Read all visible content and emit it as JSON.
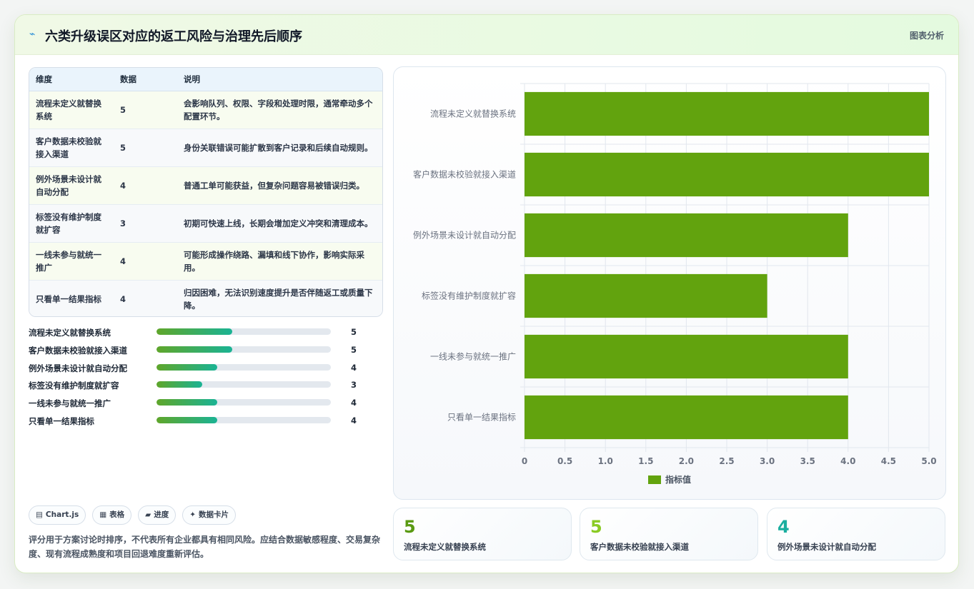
{
  "header": {
    "logo_glyph": "⌁",
    "title": "六类升级误区对应的返工风险与治理先后顺序",
    "tag": "图表分析"
  },
  "table": {
    "columns": [
      "维度",
      "数据",
      "说明"
    ],
    "rows": [
      {
        "dim": "流程未定义就替换系统",
        "value": "5",
        "desc": "会影响队列、权限、字段和处理时限，通常牵动多个配置环节。"
      },
      {
        "dim": "客户数据未校验就接入渠道",
        "value": "5",
        "desc": "身份关联错误可能扩散到客户记录和后续自动规则。"
      },
      {
        "dim": "例外场景未设计就自动分配",
        "value": "4",
        "desc": "普通工单可能获益，但复杂问题容易被错误归类。"
      },
      {
        "dim": "标签没有维护制度就扩容",
        "value": "3",
        "desc": "初期可快速上线，长期会增加定义冲突和清理成本。"
      },
      {
        "dim": "一线未参与就统一推广",
        "value": "4",
        "desc": "可能形成操作绕路、漏填和线下协作，影响实际采用。"
      },
      {
        "dim": "只看单一结果指标",
        "value": "4",
        "desc": "归因困难，无法识别速度提升是否伴随返工或质量下降。"
      }
    ]
  },
  "progress": [
    {
      "label": "流程未定义就替换系统",
      "value": 5,
      "max": 11.5
    },
    {
      "label": "客户数据未校验就接入渠道",
      "value": 5,
      "max": 11.5
    },
    {
      "label": "例外场景未设计就自动分配",
      "value": 4,
      "max": 11.5
    },
    {
      "label": "标签没有维护制度就扩容",
      "value": 3,
      "max": 11.5
    },
    {
      "label": "一线未参与就统一推广",
      "value": 4,
      "max": 11.5
    },
    {
      "label": "只看单一结果指标",
      "value": 4,
      "max": 11.5
    }
  ],
  "pills": [
    {
      "icon": "▤",
      "label": "Chart.js"
    },
    {
      "icon": "▦",
      "label": "表格"
    },
    {
      "icon": "▰",
      "label": "进度"
    },
    {
      "icon": "✦",
      "label": "数据卡片"
    }
  ],
  "note": "评分用于方案讨论时排序，不代表所有企业都具有相同风险。应结合数据敏感程度、交易复杂度、现有流程成熟度和项目回退难度重新评估。",
  "chart_data": {
    "type": "bar",
    "orientation": "horizontal",
    "categories": [
      "流程未定义就替换系统",
      "客户数据未校验就接入渠道",
      "例外场景未设计就自动分配",
      "标签没有维护制度就扩容",
      "一线未参与就统一推广",
      "只看单一结果指标"
    ],
    "series": [
      {
        "name": "指标值",
        "values": [
          5,
          5,
          4,
          3,
          4,
          4
        ],
        "color": "#62a30e"
      }
    ],
    "xlim": [
      0,
      5
    ],
    "xticks": [
      "0",
      "0.5",
      "1.0",
      "1.5",
      "2.0",
      "2.5",
      "3.0",
      "3.5",
      "4.0",
      "4.5",
      "5.0"
    ],
    "grid": true,
    "legend_position": "bottom"
  },
  "kpis": [
    {
      "value": "5",
      "label": "流程未定义就替换系统",
      "color": "#5a9a12"
    },
    {
      "value": "5",
      "label": "客户数据未校验就接入渠道",
      "color": "#8acb24"
    },
    {
      "value": "4",
      "label": "例外场景未设计就自动分配",
      "color": "#1aae9f"
    }
  ]
}
